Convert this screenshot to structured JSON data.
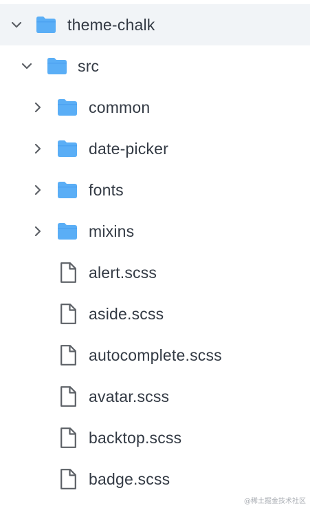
{
  "tree": {
    "root": {
      "label": "theme-chalk",
      "icon": "folder-icon",
      "expanded": true
    },
    "src": {
      "label": "src",
      "icon": "folder-icon",
      "expanded": true
    },
    "items": [
      {
        "label": "common",
        "type": "folder"
      },
      {
        "label": "date-picker",
        "type": "folder"
      },
      {
        "label": "fonts",
        "type": "folder"
      },
      {
        "label": "mixins",
        "type": "folder"
      },
      {
        "label": "alert.scss",
        "type": "file"
      },
      {
        "label": "aside.scss",
        "type": "file"
      },
      {
        "label": "autocomplete.scss",
        "type": "file"
      },
      {
        "label": "avatar.scss",
        "type": "file"
      },
      {
        "label": "backtop.scss",
        "type": "file"
      },
      {
        "label": "badge.scss",
        "type": "file"
      }
    ]
  },
  "watermark": "@稀土掘金技术社区",
  "colors": {
    "folder": "#5aaef6",
    "folder_tab": "#3d97ea",
    "file_outline": "#5c6066",
    "chevron": "#5c6066",
    "selected_bg": "#f1f4f7",
    "text": "#333a44"
  }
}
